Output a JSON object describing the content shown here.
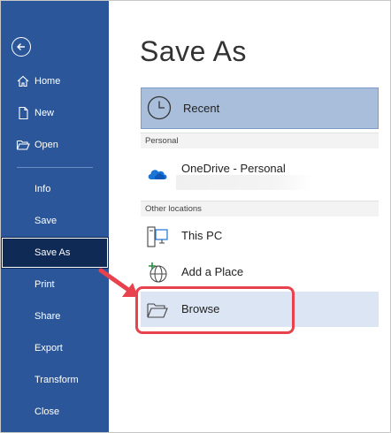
{
  "sidebar": {
    "items": [
      {
        "label": "Home",
        "icon": "home-icon"
      },
      {
        "label": "New",
        "icon": "new-document-icon"
      },
      {
        "label": "Open",
        "icon": "open-folder-icon"
      },
      {
        "label": "Info"
      },
      {
        "label": "Save"
      },
      {
        "label": "Save As",
        "active": true
      },
      {
        "label": "Print"
      },
      {
        "label": "Share"
      },
      {
        "label": "Export"
      },
      {
        "label": "Transform"
      },
      {
        "label": "Close"
      }
    ]
  },
  "main": {
    "title": "Save As",
    "recent_label": "Recent",
    "personal_header": "Personal",
    "onedrive_label": "OneDrive - Personal",
    "other_header": "Other locations",
    "this_pc_label": "This PC",
    "add_place_label": "Add a Place",
    "browse_label": "Browse"
  },
  "colors": {
    "sidebar_bg": "#2b579a",
    "active_item_bg": "#0f2a55",
    "recent_bg": "#a8bedb",
    "browse_hover_bg": "#dce5f3",
    "annotation_red": "#e8424e"
  }
}
